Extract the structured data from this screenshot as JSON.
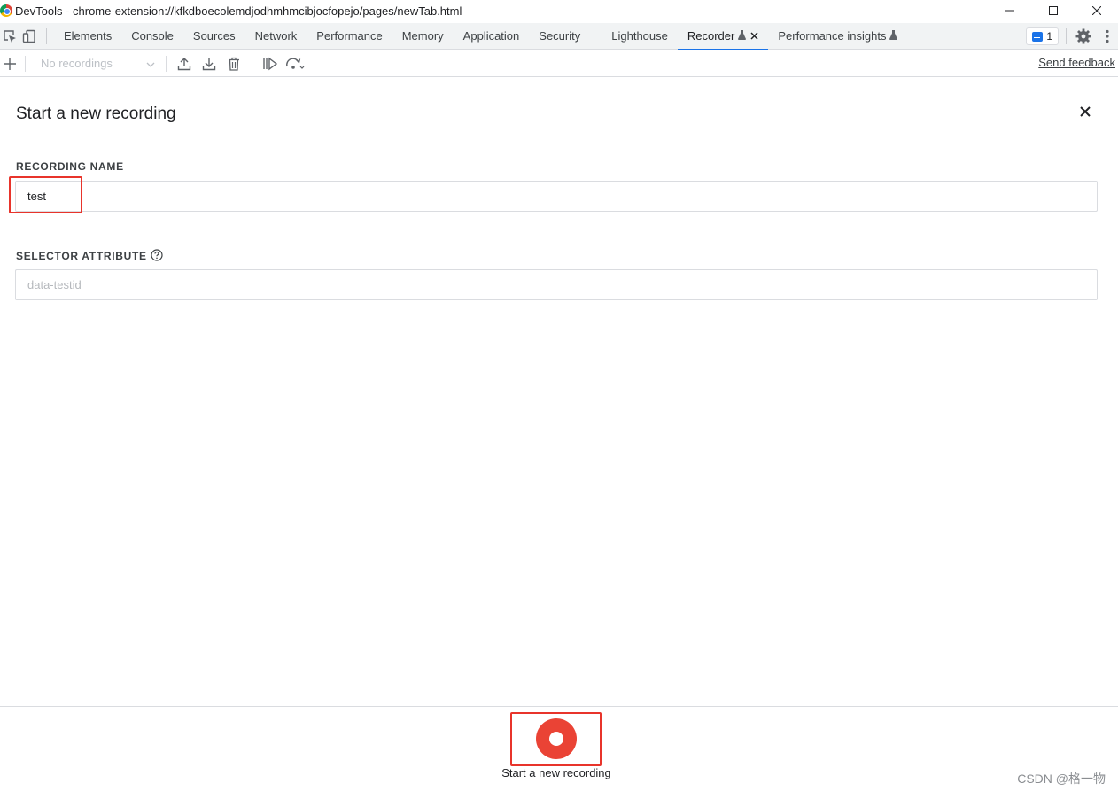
{
  "window": {
    "title": "DevTools - chrome-extension://kfkdboecolemdjodhmhmcibjocfopejo/pages/newTab.html",
    "minimize_icon": "minimize-icon",
    "maximize_icon": "maximize-icon",
    "close_icon": "close-icon"
  },
  "tabs": [
    {
      "label": "Elements"
    },
    {
      "label": "Console"
    },
    {
      "label": "Sources"
    },
    {
      "label": "Network"
    },
    {
      "label": "Performance"
    },
    {
      "label": "Memory"
    },
    {
      "label": "Application"
    },
    {
      "label": "Security"
    },
    {
      "label": "Lighthouse"
    },
    {
      "label": "Recorder"
    },
    {
      "label": "Performance insights"
    }
  ],
  "issues": {
    "count": "1"
  },
  "toolbar": {
    "recordings_placeholder": "No recordings",
    "send_feedback": "Send feedback"
  },
  "form": {
    "title": "Start a new recording",
    "recording_name_label": "RECORDING NAME",
    "recording_name_value": "test",
    "selector_label": "SELECTOR ATTRIBUTE",
    "selector_placeholder": "data-testid"
  },
  "footer": {
    "record_label": "Start a new recording"
  },
  "watermark": "CSDN @格一物",
  "colors": {
    "accent": "#1a73e8",
    "record": "#ea4335",
    "highlight": "#e8342b"
  }
}
